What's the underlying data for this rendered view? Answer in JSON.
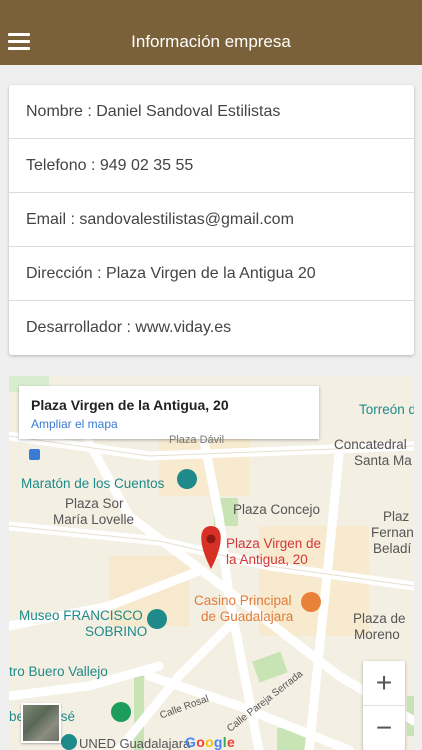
{
  "header": {
    "title": "Información empresa",
    "menu_icon": "hamburger-menu-icon"
  },
  "info": {
    "rows": [
      "Nombre : Daniel Sandoval Estilistas",
      "Telefono : 949 02 35 55",
      "Email : sandovalestilistas@gmail.com",
      "Dirección : Plaza Virgen de la Antigua 20",
      "Desarrollador : www.viday.es"
    ]
  },
  "map": {
    "infobox_title": "Plaza Virgen de la Antigua, 20",
    "infobox_link": "Ampliar el mapa",
    "labels": {
      "torreon": "Torreón d",
      "concatedral": "Concatedral",
      "santa_ma": "Santa Ma",
      "maraton": "Maratón de los Cuentos",
      "plaza_sor": "Plaza Sor",
      "maria_lovelle": "María Lovelle",
      "plaza_concejo": "Plaza Concejo",
      "plaza_fernan_1": "Plaz",
      "plaza_fernan_2": "Fernan",
      "plaza_fernan_3": "Beladí",
      "pin_line1": "Plaza Virgen de",
      "pin_line2": "la Antigua, 20",
      "casino_line1": "Casino Principal",
      "casino_line2": "de Guadalajara",
      "museo_line1": "Museo FRANCISCO",
      "museo_line2": "SOBRINO",
      "plaza_moreno_1": "Plaza de",
      "plaza_moreno_2": "Moreno",
      "buero": "tro Buero Vallejo",
      "san_jose": "be   an José",
      "uned": "UNED Guadalajara",
      "calle_rosal": "Calle Rosal",
      "calle_pareja": "Calle Pareja Serrada",
      "partial_top": "Plaza Dávil"
    },
    "zoom_in": "+",
    "zoom_out": "−",
    "google": "Google",
    "colors": {
      "pin": "#d93025",
      "teal_poi": "#1f8a8a",
      "green_poi": "#1e9c5a",
      "orange_poi": "#e8823a",
      "park": "#c8e4b4"
    }
  }
}
